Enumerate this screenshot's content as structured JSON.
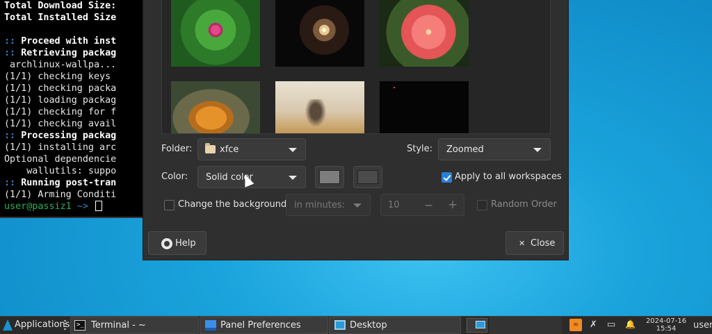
{
  "terminal": {
    "lines": [
      {
        "t": "Total Download Size:",
        "s": "bold"
      },
      {
        "t": "Total Installed Size",
        "s": "bold"
      },
      {
        "t": "",
        "s": ""
      },
      {
        "p": ":: ",
        "t": "Proceed with inst",
        "s": "bold"
      },
      {
        "p": ":: ",
        "t": "Retrieving packag",
        "s": "bold"
      },
      {
        "t": " archlinux-wallpa...",
        "s": ""
      },
      {
        "t": "(1/1) checking keys",
        "s": ""
      },
      {
        "t": "(1/1) checking packa",
        "s": ""
      },
      {
        "t": "(1/1) loading packag",
        "s": ""
      },
      {
        "t": "(1/1) checking for f",
        "s": ""
      },
      {
        "t": "(1/1) checking avail",
        "s": ""
      },
      {
        "p": ":: ",
        "t": "Processing packag",
        "s": "bold"
      },
      {
        "t": "(1/1) installing arc",
        "s": ""
      },
      {
        "t": "Optional dependencie",
        "s": ""
      },
      {
        "t": "    wallutils: suppo",
        "s": ""
      },
      {
        "p": ":: ",
        "t": "Running post-tran",
        "s": "bold"
      },
      {
        "t": "(1/1) Arming Conditi",
        "s": ""
      }
    ],
    "prompt_user": "user@passiz1",
    "prompt_arrow": " ~> "
  },
  "dialog": {
    "folder_label": "Folder:",
    "folder_value": "xfce",
    "style_label": "Style:",
    "style_value": "Zoomed",
    "color_label": "Color:",
    "color_value": "Solid color",
    "swatch_1": "#7d7d7d",
    "swatch_2": "#4b4b4b",
    "apply_all_label": "Apply to all workspaces",
    "change_bg_label": "Change the background",
    "interval_value": "in minutes:",
    "interval_number": "10",
    "minus": "−",
    "plus": "+",
    "random_label": "Random Order",
    "help_label": "Help",
    "close_label": "Close",
    "close_glyph": "✕"
  },
  "taskbar": {
    "applications_label": "Applications",
    "terminal_label": "Terminal - ~",
    "terminal_glyph": ">_",
    "panel_prefs_label": "Panel Preferences",
    "desktop_label": "Desktop",
    "date": "2024-07-16",
    "time": "15:54",
    "user": "user",
    "tray_orange_glyph": "∞",
    "tray_network_glyph": "✗",
    "tray_battery_glyph": "▭",
    "tray_bell_glyph": "🔔",
    "accent": "#1793d1"
  }
}
